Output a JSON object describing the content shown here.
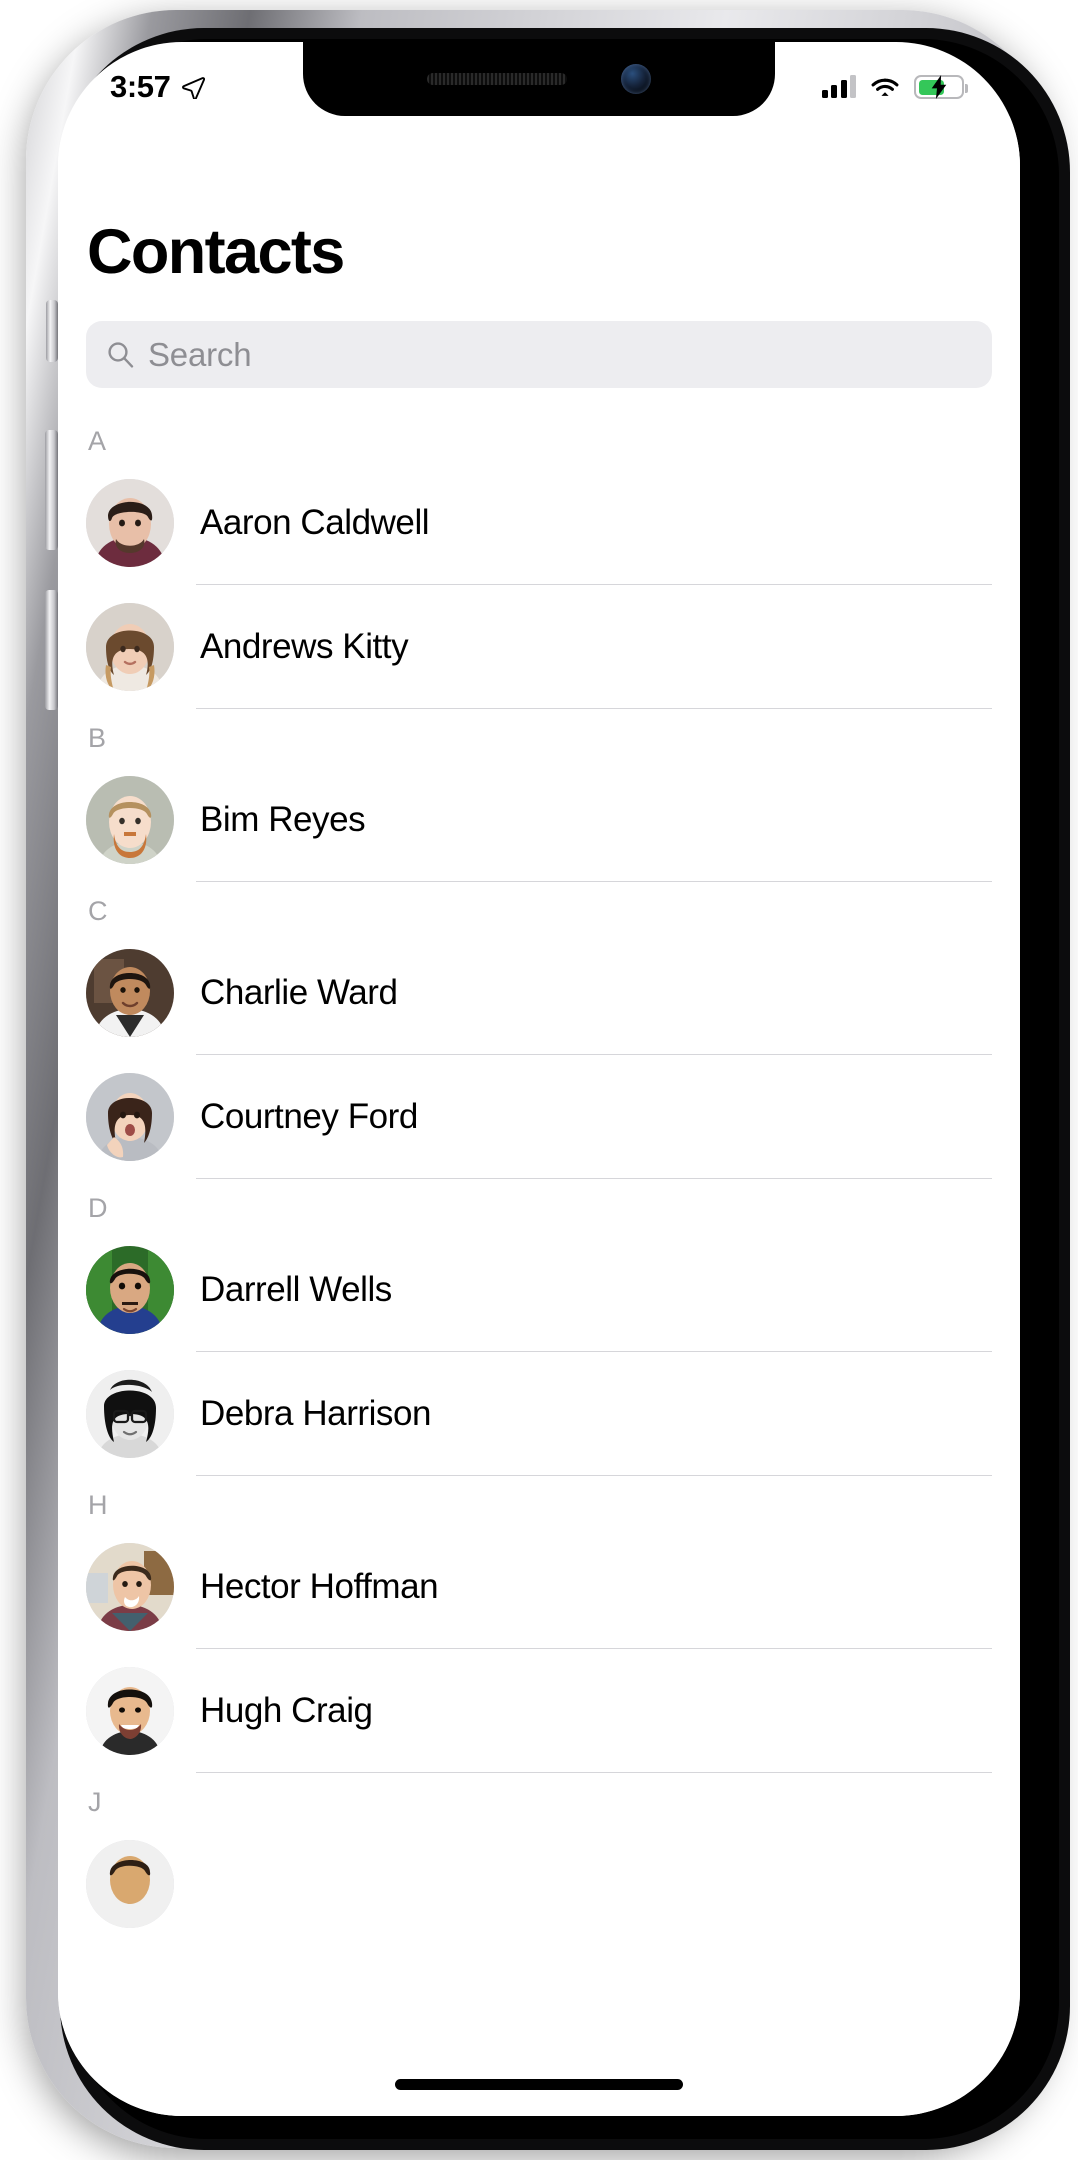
{
  "status_bar": {
    "time": "3:57",
    "location_icon": "location-arrow-icon",
    "cellular_icon": "cellular-signal-icon",
    "cellular_bars_filled": 3,
    "cellular_bars_total": 4,
    "wifi_icon": "wifi-icon",
    "battery_icon": "battery-charging-icon",
    "battery_level_percent": 62,
    "battery_charging": true,
    "battery_color": "#34c759"
  },
  "header": {
    "title": "Contacts"
  },
  "search": {
    "placeholder": "Search",
    "icon": "search-icon",
    "value": ""
  },
  "sections": [
    {
      "letter": "A",
      "contacts": [
        {
          "name": "Aaron Caldwell",
          "avatar": "photo-man-beard-maroon-shirt"
        },
        {
          "name": "Andrews Kitty",
          "avatar": "photo-woman-curly-ombre-hair"
        }
      ]
    },
    {
      "letter": "B",
      "contacts": [
        {
          "name": "Bim Reyes",
          "avatar": "photo-man-ginger-beard"
        }
      ]
    },
    {
      "letter": "C",
      "contacts": [
        {
          "name": "Charlie Ward",
          "avatar": "photo-man-white-shirt"
        },
        {
          "name": "Courtney Ford",
          "avatar": "photo-woman-hand-on-mouth"
        }
      ]
    },
    {
      "letter": "D",
      "contacts": [
        {
          "name": "Darrell Wells",
          "avatar": "photo-man-blue-hoodie-green-bg"
        },
        {
          "name": "Debra Harrison",
          "avatar": "photo-woman-glasses-bw"
        }
      ]
    },
    {
      "letter": "H",
      "contacts": [
        {
          "name": "Hector Hoffman",
          "avatar": "photo-man-plaid-shirt"
        },
        {
          "name": "Hugh Craig",
          "avatar": "photo-man-smiling-dark-hair"
        }
      ]
    },
    {
      "letter": "J",
      "contacts": []
    }
  ],
  "home_indicator": "home-indicator-bar",
  "colors": {
    "background": "#ffffff",
    "text_primary": "#000000",
    "text_secondary": "#8e8e93",
    "section_letter": "#a4a4a8",
    "search_field": "#ededf0",
    "divider": "#d6d6da",
    "battery_green": "#34c759"
  }
}
